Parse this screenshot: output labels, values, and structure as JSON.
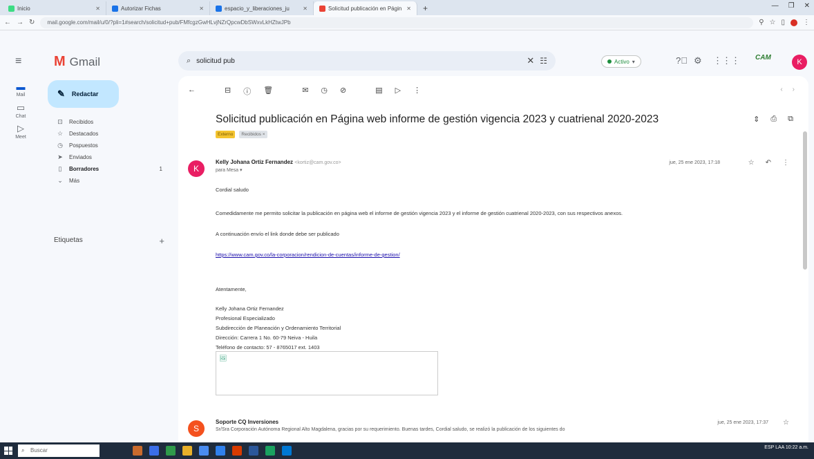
{
  "browser": {
    "tabs": [
      {
        "label": "Inicio",
        "active": false,
        "color": "#3ddc84"
      },
      {
        "label": "Autorizar Fichas",
        "active": false,
        "color": "#1a73e8"
      },
      {
        "label": "espacio_y_liberaciones_ju",
        "active": false,
        "color": "#1a73e8"
      },
      {
        "label": "Solicitud publicación en Págin",
        "active": true,
        "color": "#ea4335"
      }
    ],
    "new_tab": "+",
    "url": "mail.google.com/mail/u/0/?pli=1#search/solicitud+pub/FMfcgzGwHLvjNZrQpcwDbSWxvLkHZtwJPb"
  },
  "gmail": {
    "app_name": "Gmail",
    "rail": [
      {
        "label": "Mail",
        "icon": "mail-icon"
      },
      {
        "label": "Chat",
        "icon": "chat-icon"
      },
      {
        "label": "Meet",
        "icon": "meet-icon"
      }
    ],
    "compose_label": "Redactar",
    "folders": [
      {
        "label": "Recibidos",
        "icon": "inbox-icon",
        "count": ""
      },
      {
        "label": "Destacados",
        "icon": "star-icon",
        "count": ""
      },
      {
        "label": "Pospuestos",
        "icon": "clock-icon",
        "count": ""
      },
      {
        "label": "Enviados",
        "icon": "send-icon",
        "count": ""
      },
      {
        "label": "Borradores",
        "icon": "draft-icon",
        "count": "1"
      },
      {
        "label": "Más",
        "icon": "chevron-down-icon",
        "count": ""
      }
    ],
    "labels_heading": "Etiquetas",
    "search_value": "solicitud pub",
    "status_label": "Activo",
    "brand_logo": "CAM",
    "avatar_letter": "K"
  },
  "thread": {
    "subject": "Solicitud publicación en Página web informe de gestión vigencia 2023 y cuatrienal 2020-2023",
    "chips": [
      "Externo",
      "Recibidos ×"
    ],
    "messages": [
      {
        "avatar": "K",
        "avatar_color": "#e91e63",
        "sender": "Kelly Johana Ortiz Fernandez",
        "email": "<kortiz@cam.gov.co>",
        "to": "para Mesa ▾",
        "date": "jue, 25 ene 2023, 17:18",
        "body": {
          "greeting": "Cordial saludo",
          "p1": "Comedidamente me permito solicitar la publicación en página web el informe de gestión vigencia 2023 y el informe de gestión cuatrienal 2020-2023, con sus respectivos anexos.",
          "p2": "A continuación envío el link donde debe ser publicado",
          "link": "https://www.cam.gov.co/la-corporacion/rendicion-de-cuentas/informe-de-gestion/",
          "closing": "Atentamente,",
          "sig": [
            "Kelly Johana Ortiz Fernandez",
            "Profesional Especializado",
            "Subdirección de Planeación y Ordenamiento Territorial",
            "Dirección: Carrera 1 No. 60-79 Neiva - Huila",
            "Teléfono de contacto: 57 - 8765017 ext. 1403"
          ]
        }
      },
      {
        "avatar": "S",
        "avatar_color": "#f4511e",
        "sender": "Soporte CQ Inversiones",
        "date": "jue, 25 ene 2023, 17:37",
        "snippet": "Sr/Sra Corporación Autónoma Regional Alto Magdalena, gracias por su requerimiento. Buenas tardes, Cordial saludo, se realizó la publicación de los siguientes do"
      }
    ]
  },
  "taskbar": {
    "search_placeholder": "Buscar",
    "app_colors": [
      "#c96b2d",
      "#3b6ee8",
      "#2f9a4a",
      "#e8b02a",
      "#4a8cf0",
      "#2f80ed",
      "#d83b01",
      "#2b579a",
      "#1aa260",
      "#0078d4"
    ],
    "tray": "ESP LAA  10:22 a.m."
  }
}
